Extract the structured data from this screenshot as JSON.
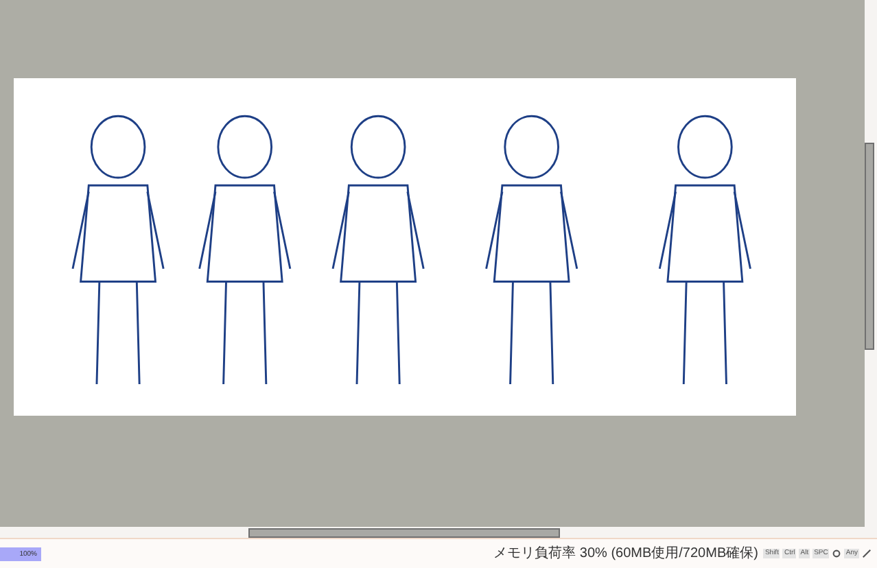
{
  "zoom": {
    "label": "100%",
    "level": 1
  },
  "status_bar": {
    "memory": "メモリ負荷率 30% (60MB使用/720MB確保)",
    "keys": [
      "Shift",
      "Ctrl",
      "Alt",
      "SPC"
    ],
    "any": "Any"
  }
}
